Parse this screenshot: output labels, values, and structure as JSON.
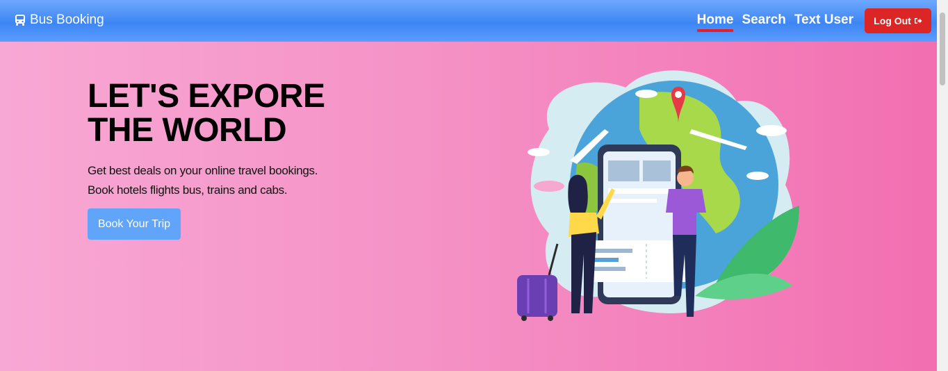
{
  "nav": {
    "brand": "Bus Booking",
    "brand_icon": "bus-icon",
    "links": [
      {
        "label": "Home",
        "active": true
      },
      {
        "label": "Search",
        "active": false
      },
      {
        "label": "Text User",
        "active": false
      }
    ],
    "logout_label": "Log Out",
    "logout_icon": "sign-out-icon"
  },
  "hero": {
    "headline_line1": "LET'S EXPORE",
    "headline_line2": "THE WORLD",
    "tagline_line1": "Get best deals on your online travel bookings.",
    "tagline_line2": "Book hotels flights bus, trains and cabs.",
    "cta_label": "Book Your Trip",
    "illustration": "travel-globe-illustration"
  },
  "colors": {
    "navbar": "#3d86f3",
    "active_underline": "#e0202a",
    "logout": "#dc2626",
    "cta": "#60a5fa",
    "hero_start": "#f8a8d4",
    "hero_end": "#f26fb1"
  }
}
